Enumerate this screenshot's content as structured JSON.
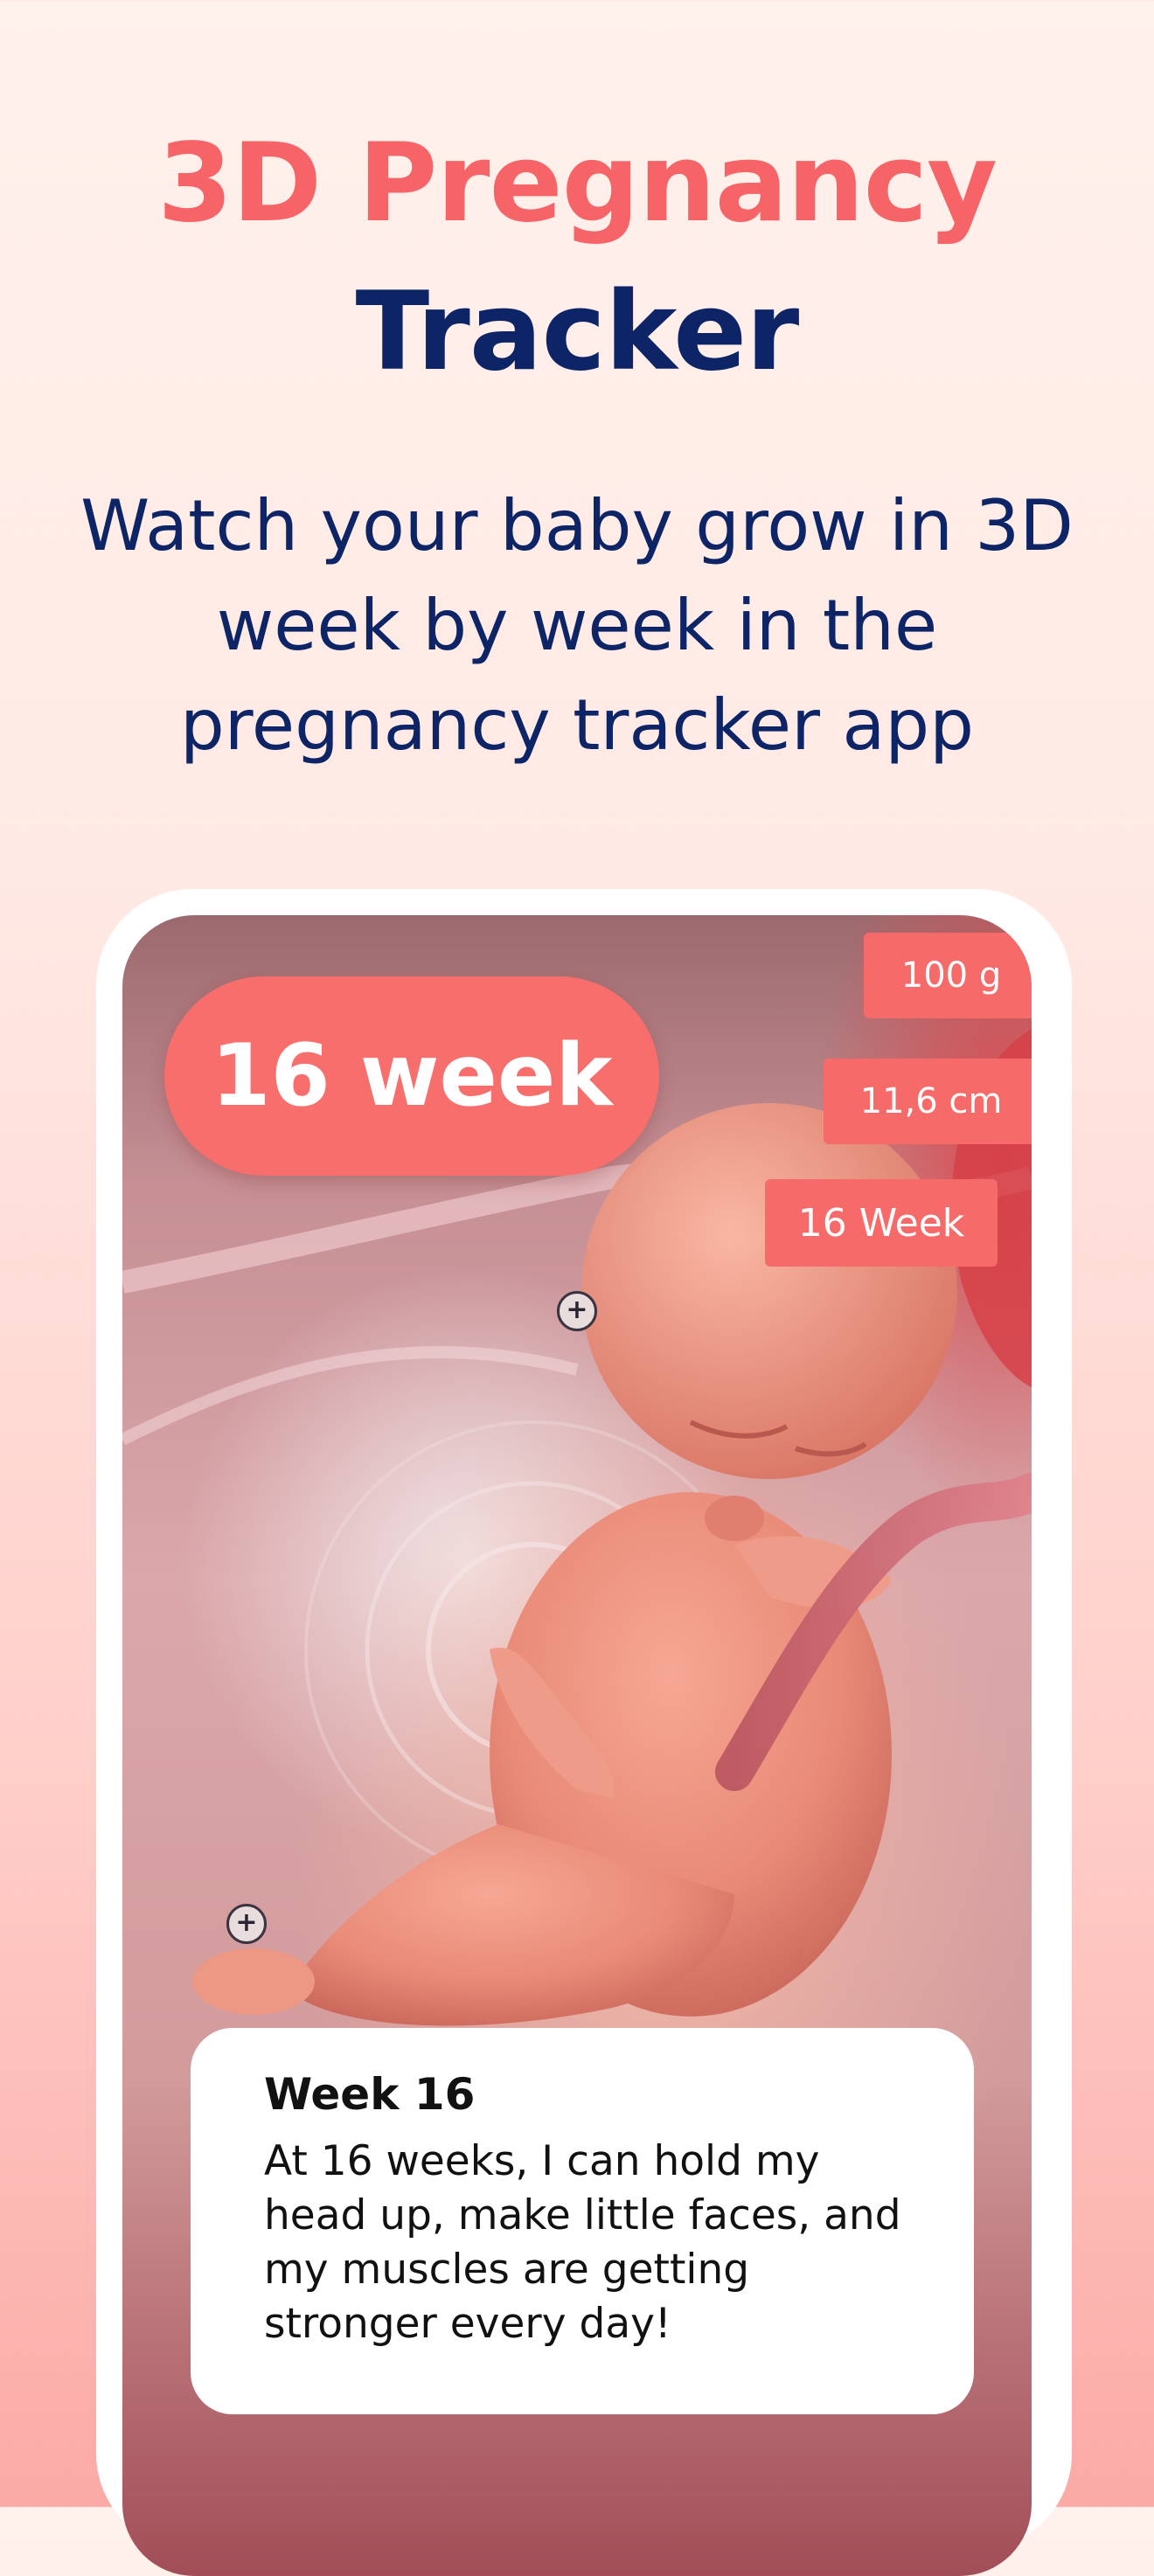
{
  "header": {
    "title_accent": "3D Pregnancy",
    "title_main": "Tracker",
    "subtitle": "Watch your baby grow in 3D week by week in the pregnancy tracker app"
  },
  "colors": {
    "accent": "#f76467",
    "navy": "#0d2566",
    "pill": "#f76e6c",
    "card": "#ffffff"
  },
  "phone": {
    "week_badge": "16 week",
    "stats": {
      "weight": "100 g",
      "length": "11,6 cm",
      "week": "16 Week"
    },
    "hotspots": {
      "icon": "plus-icon",
      "symbol": "+"
    },
    "info_card": {
      "title": "Week 16",
      "text": "At 16 weeks, I can hold my head up, make little faces, and my muscles are getting stronger every day!"
    }
  }
}
